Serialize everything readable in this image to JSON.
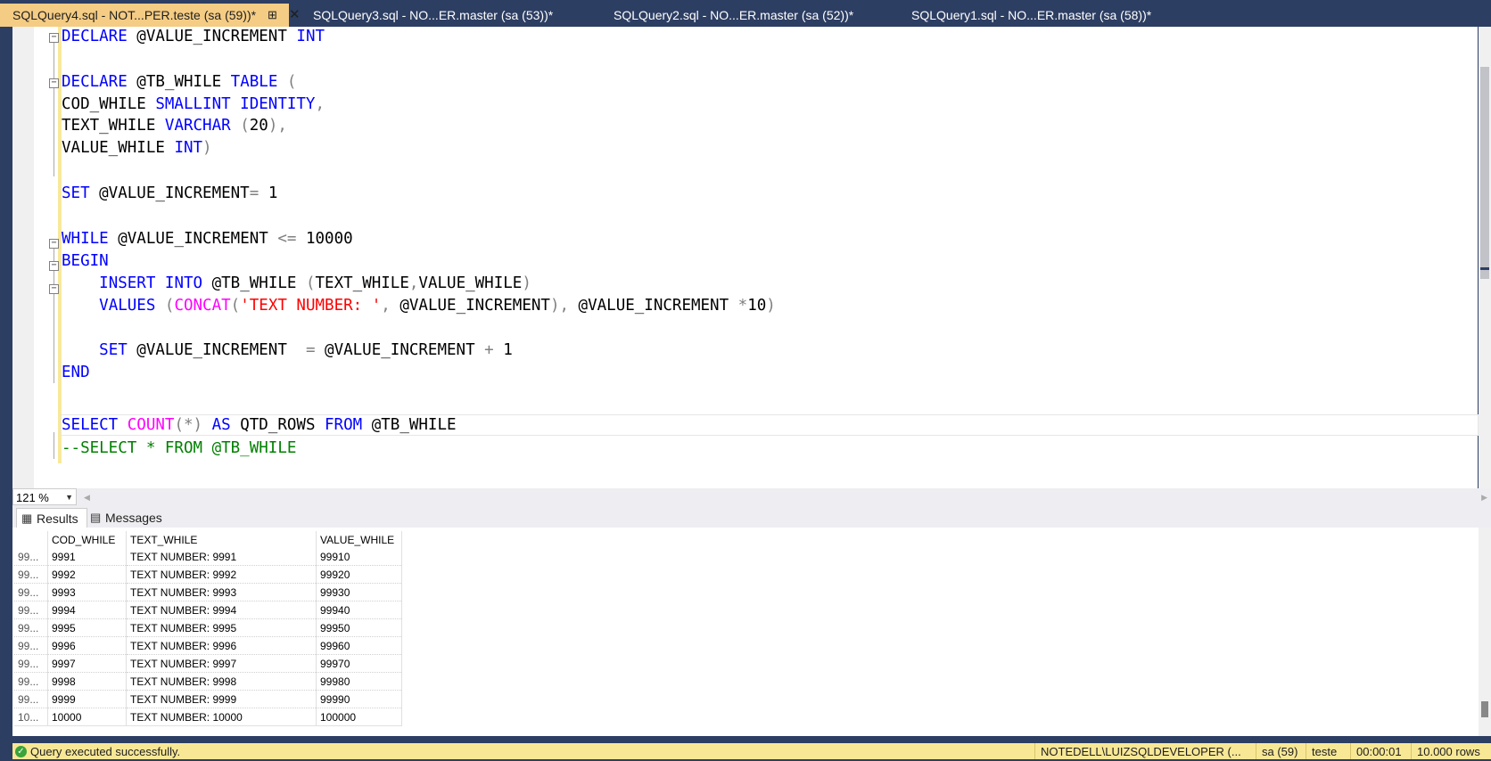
{
  "tabs": [
    {
      "label": "SQLQuery4.sql - NOT...PER.teste (sa (59))*",
      "active": true
    },
    {
      "label": "SQLQuery3.sql - NO...ER.master (sa (53))*",
      "active": false
    },
    {
      "label": "SQLQuery2.sql - NO...ER.master (sa (52))*",
      "active": false
    },
    {
      "label": "SQLQuery1.sql - NO...ER.master (sa (58))*",
      "active": false
    }
  ],
  "tab_icons": {
    "pin": "pin-icon",
    "close": "close-icon"
  },
  "code": {
    "l1_kw": "DECLARE",
    "l1_var": " @VALUE_INCREMENT ",
    "l1_type": "INT",
    "l3_kw": "DECLARE",
    "l3_var": " @TB_WHILE ",
    "l3_kw2": "TABLE",
    "l3_op": " (",
    "l4_col": "COD_WHILE ",
    "l4_type": "SMALLINT IDENTITY",
    "l4_op": ",",
    "l5_col": "TEXT_WHILE ",
    "l5_type": "VARCHAR",
    "l5_op1": " (",
    "l5_num": "20",
    "l5_op2": "),",
    "l6_col": "VALUE_WHILE ",
    "l6_type": "INT",
    "l6_op": ")",
    "l8_kw": "SET",
    "l8_var": " @VALUE_INCREMENT",
    "l8_op": "=",
    "l8_num": " 1",
    "l10_kw": "WHILE",
    "l10_var": " @VALUE_INCREMENT ",
    "l10_op": "<=",
    "l10_num": " 10000",
    "l11_kw": "BEGIN",
    "l12_indent": "    ",
    "l12_kw": "INSERT INTO",
    "l12_var": " @TB_WHILE ",
    "l12_op1": "(",
    "l12_col": "TEXT_WHILE",
    "l12_op2": ",",
    "l12_col2": "VALUE_WHILE",
    "l12_op3": ")",
    "l13_indent": "    ",
    "l13_kw": "VALUES",
    "l13_op1": " (",
    "l13_fn": "CONCAT",
    "l13_op2": "(",
    "l13_str": "'TEXT NUMBER: '",
    "l13_op3": ",",
    "l13_var": " @VALUE_INCREMENT",
    "l13_op4": "),",
    "l13_var2": " @VALUE_INCREMENT ",
    "l13_op5": "*",
    "l13_num": "10",
    "l13_op6": ")",
    "l15_indent": "    ",
    "l15_kw": "SET",
    "l15_var": " @VALUE_INCREMENT  ",
    "l15_op1": "=",
    "l15_var2": " @VALUE_INCREMENT ",
    "l15_op2": "+",
    "l15_num": " 1",
    "l16_kw": "END",
    "l18_kw": "SELECT",
    "l18_fn": " COUNT",
    "l18_op": "(*)",
    "l18_kw2": " AS",
    "l18_col": " QTD_ROWS ",
    "l18_kw3": "FROM",
    "l18_var": " @TB_WHILE",
    "l19_comment": "--SELECT * FROM @TB_WHILE"
  },
  "zoom": {
    "value": "121 %"
  },
  "results_tabs": [
    {
      "label": "Results",
      "icon": "grid-icon"
    },
    {
      "label": "Messages",
      "icon": "messages-icon"
    }
  ],
  "results": {
    "columns": [
      "",
      "COD_WHILE",
      "TEXT_WHILE",
      "VALUE_WHILE"
    ],
    "rows": [
      [
        "99...",
        "9991",
        "TEXT NUMBER: 9991",
        "99910"
      ],
      [
        "99...",
        "9992",
        "TEXT NUMBER: 9992",
        "99920"
      ],
      [
        "99...",
        "9993",
        "TEXT NUMBER: 9993",
        "99930"
      ],
      [
        "99...",
        "9994",
        "TEXT NUMBER: 9994",
        "99940"
      ],
      [
        "99...",
        "9995",
        "TEXT NUMBER: 9995",
        "99950"
      ],
      [
        "99...",
        "9996",
        "TEXT NUMBER: 9996",
        "99960"
      ],
      [
        "99...",
        "9997",
        "TEXT NUMBER: 9997",
        "99970"
      ],
      [
        "99...",
        "9998",
        "TEXT NUMBER: 9998",
        "99980"
      ],
      [
        "99...",
        "9999",
        "TEXT NUMBER: 9999",
        "99990"
      ],
      [
        "10...",
        "10000",
        "TEXT NUMBER: 10000",
        "100000"
      ]
    ]
  },
  "status": {
    "message": "Query executed successfully.",
    "server": "NOTEDELL\\LUIZSQLDEVELOPER (...",
    "user": "sa (59)",
    "database": "teste",
    "elapsed": "00:00:01",
    "rows": "10.000 rows"
  },
  "colors": {
    "active_tab": "#f5cc84",
    "chrome": "#2d3e63",
    "status_bar": "#f8e896",
    "keyword": "#0000ff",
    "function": "#ff00ff",
    "string": "#ff0000",
    "comment": "#008000"
  }
}
